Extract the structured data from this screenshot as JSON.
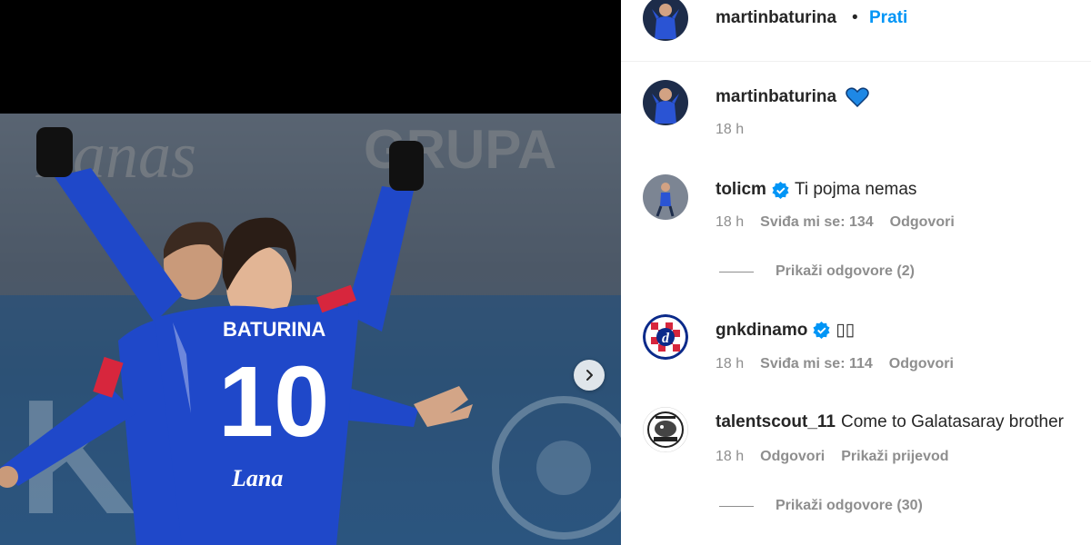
{
  "header": {
    "username": "martinbaturina",
    "separator": "•",
    "follow_label": "Prati"
  },
  "caption": {
    "username": "martinbaturina",
    "emoji": "💙",
    "time": "18 h"
  },
  "comments": [
    {
      "username": "tolicm",
      "verified": true,
      "text": "Ti pojma nemas",
      "time": "18 h",
      "likes": "Sviđa mi se: 134",
      "reply": "Odgovori",
      "view_replies": "Prikaži odgovore (2)"
    },
    {
      "username": "gnkdinamo",
      "verified": true,
      "text": "▯▯",
      "time": "18 h",
      "likes": "Sviđa mi se: 114",
      "reply": "Odgovori"
    },
    {
      "username": "talentscout_11",
      "verified": false,
      "text": "Come to Galatasaray brother",
      "time": "18 h",
      "reply": "Odgovori",
      "translate": "Prikaži prijevod",
      "view_replies": "Prikaži odgovore (30)"
    }
  ],
  "photo": {
    "jersey_name": "BATURINA",
    "jersey_number": "10",
    "sponsor": "Lana",
    "icon": "chevron-right-icon"
  },
  "colors": {
    "accent": "#0095f6",
    "verified": "#0095f6",
    "heart": "#1e88e5",
    "kit_blue": "#1f48c9"
  }
}
